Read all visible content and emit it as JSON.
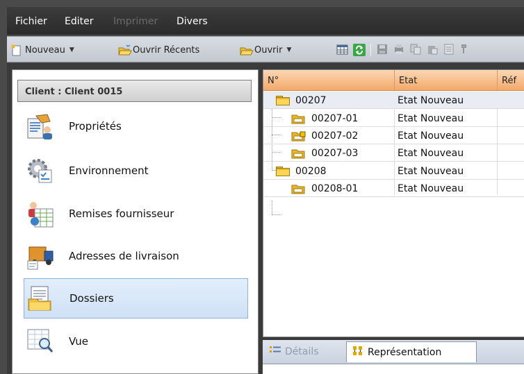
{
  "menubar": {
    "items": [
      {
        "label": "Fichier",
        "enabled": true
      },
      {
        "label": "Editer",
        "enabled": true
      },
      {
        "label": "Imprimer",
        "enabled": false
      },
      {
        "label": "Divers",
        "enabled": true
      }
    ]
  },
  "toolbar": {
    "new_label": "Nouveau",
    "open_recent_label": "Ouvrir Récents",
    "open_label": "Ouvrir"
  },
  "left_panel": {
    "header": "Client : Client 0015",
    "items": [
      {
        "label": "Propriétés",
        "icon": "properties-icon",
        "selected": false
      },
      {
        "label": "Environnement",
        "icon": "environment-gear-icon",
        "selected": false
      },
      {
        "label": "Remises fournisseur",
        "icon": "supplier-discount-icon",
        "selected": false
      },
      {
        "label": "Adresses de livraison",
        "icon": "delivery-truck-icon",
        "selected": false
      },
      {
        "label": "Dossiers",
        "icon": "folders-icon",
        "selected": true
      },
      {
        "label": "Vue",
        "icon": "view-magnifier-icon",
        "selected": false
      }
    ]
  },
  "grid": {
    "columns": [
      "N°",
      "Etat",
      "Réf"
    ],
    "rows": [
      {
        "no": "00207",
        "etat": "Etat Nouveau",
        "level": 0,
        "icon": "folder-icon"
      },
      {
        "no": "00207-01",
        "etat": "Etat Nouveau",
        "level": 1,
        "icon": "subfolder-icon"
      },
      {
        "no": "00207-02",
        "etat": "Etat Nouveau",
        "level": 1,
        "icon": "subfolder-locked-icon"
      },
      {
        "no": "00207-03",
        "etat": "Etat Nouveau",
        "level": 1,
        "icon": "subfolder-icon"
      },
      {
        "no": "00208",
        "etat": "Etat Nouveau",
        "level": 0,
        "icon": "folder-icon"
      },
      {
        "no": "00208-01",
        "etat": "Etat Nouveau",
        "level": 1,
        "icon": "subfolder-icon"
      }
    ]
  },
  "bottom_tabs": [
    {
      "label": "Détails",
      "active": false
    },
    {
      "label": "Représentation",
      "active": true
    }
  ]
}
